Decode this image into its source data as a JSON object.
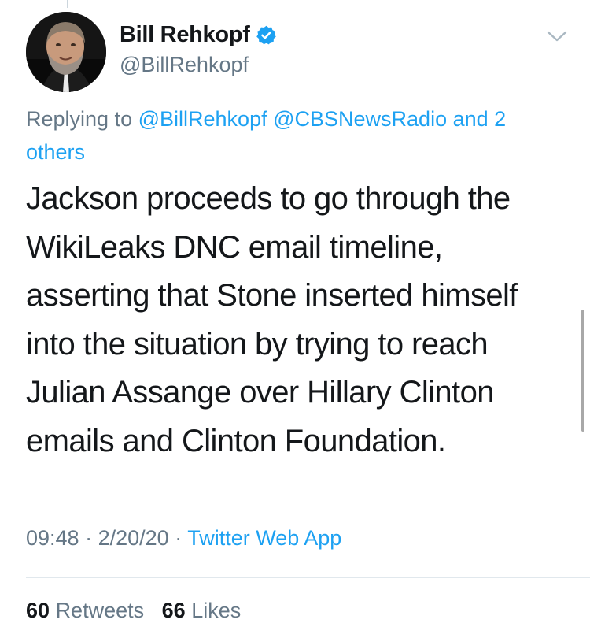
{
  "author": {
    "name": "Bill Rehkopf",
    "handle": "@BillRehkopf",
    "verified": true
  },
  "reply": {
    "prefix": "Replying to",
    "mention1": "@BillRehkopf",
    "mention2": "@CBSNewsRadio",
    "others": "and 2 others"
  },
  "tweet": {
    "text": "Jackson proceeds to go through the WikiLeaks DNC email timeline, asserting that Stone inserted himself into the situation by trying to reach Julian Assange over Hillary Clinton emails and Clinton Foundation."
  },
  "meta": {
    "time": "09:48",
    "date": "2/20/20",
    "separator": "·",
    "app": "Twitter Web App"
  },
  "stats": {
    "retweets_count": "60",
    "retweets_label": "Retweets",
    "likes_count": "66",
    "likes_label": "Likes"
  },
  "colors": {
    "accent": "#1da1f2",
    "secondary_text": "#657786",
    "primary_text": "#14171a"
  }
}
